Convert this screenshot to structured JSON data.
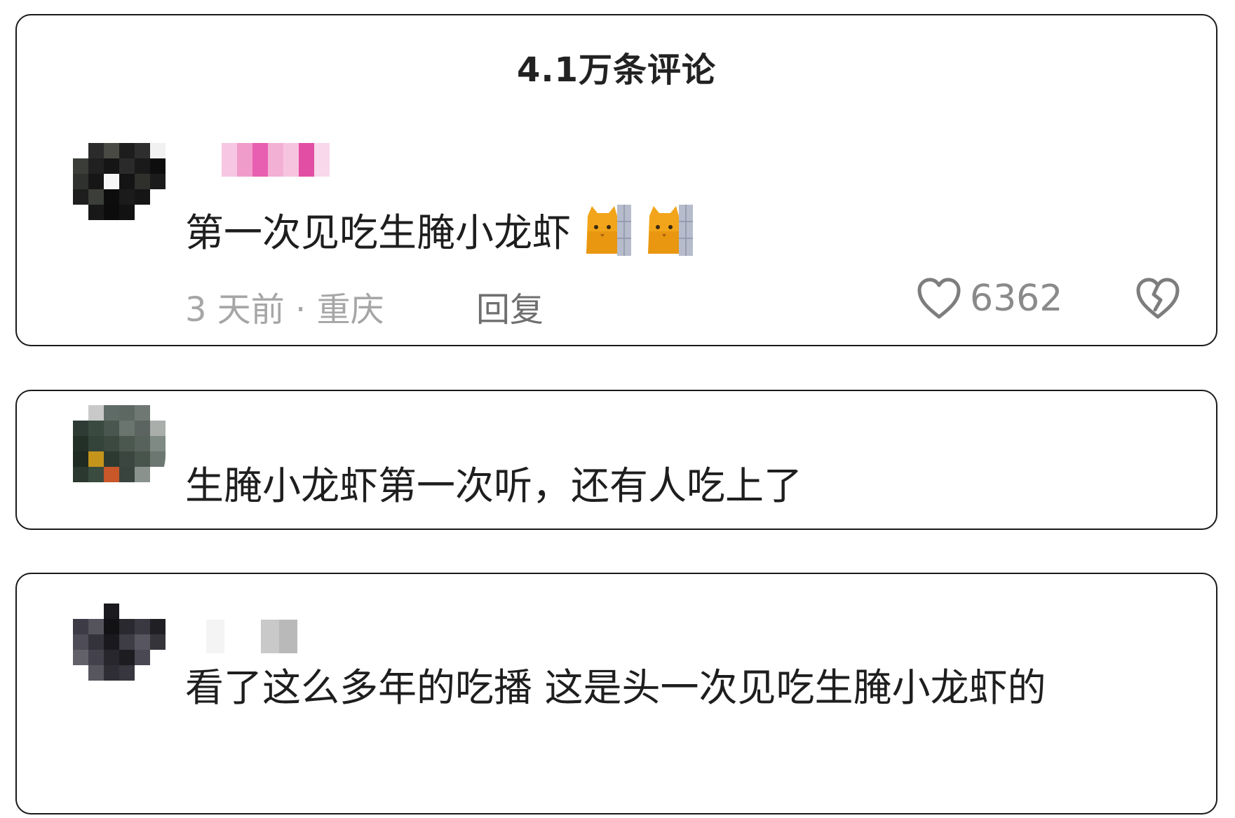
{
  "header": {
    "title": "4.1万条评论"
  },
  "comments": [
    {
      "text": "第一次见吃生腌小龙虾",
      "emoji": [
        "cat-peeking-emoji",
        "cat-peeking-emoji"
      ],
      "time_location": "3 天前 · 重庆",
      "reply_label": "回复",
      "like_count": "6362"
    },
    {
      "text": "生腌小龙虾第一次听，还有人吃上了"
    },
    {
      "text": "看了这么多年的吃播 这是头一次见吃生腌小龙虾的"
    }
  ],
  "icons": {
    "like": "heart-outline-icon",
    "dislike": "broken-heart-icon"
  },
  "colors": {
    "text": "#1e1e1e",
    "meta": "#a6a6a6",
    "border": "#1a1a1a"
  }
}
